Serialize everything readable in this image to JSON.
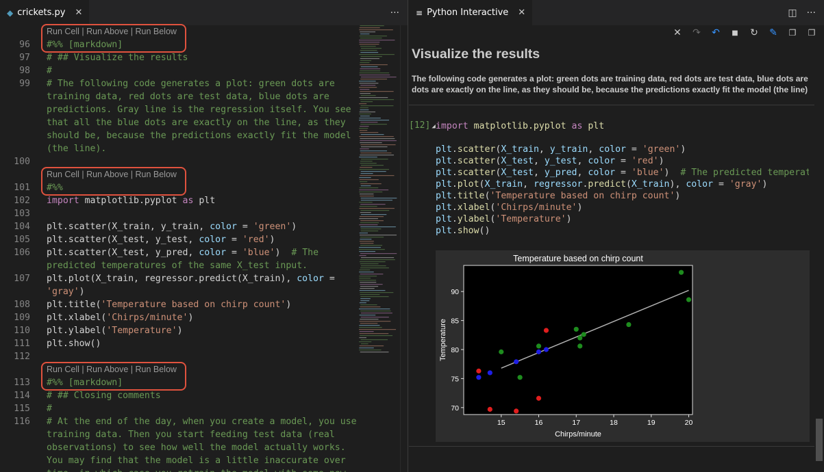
{
  "left_tab": {
    "title": "crickets.py",
    "more": "···"
  },
  "right_tab": {
    "title": "Python Interactive",
    "more": "···"
  },
  "codelens": "Run Cell | Run Above | Run Below",
  "editor_lines": [
    {
      "n": "",
      "lens": true
    },
    {
      "n": "96",
      "parts": [
        [
          "c-com",
          "#%% [markdown]"
        ]
      ]
    },
    {
      "n": "97",
      "parts": [
        [
          "c-com",
          "# ## Visualize the results"
        ]
      ]
    },
    {
      "n": "98",
      "parts": [
        [
          "c-com",
          "#"
        ]
      ]
    },
    {
      "n": "99",
      "parts": [
        [
          "c-com",
          "# The following code generates a plot: green dots are"
        ]
      ]
    },
    {
      "n": "",
      "parts": [
        [
          "c-com",
          "training data, red dots are test data, blue dots are"
        ]
      ]
    },
    {
      "n": "",
      "parts": [
        [
          "c-com",
          "predictions. Gray line is the regression itself. You see"
        ]
      ]
    },
    {
      "n": "",
      "parts": [
        [
          "c-com",
          "that all the blue dots are exactly on the line, as they"
        ]
      ]
    },
    {
      "n": "",
      "parts": [
        [
          "c-com",
          "should be, because the predictions exactly fit the model"
        ]
      ]
    },
    {
      "n": "",
      "parts": [
        [
          "c-com",
          "(the line)."
        ]
      ]
    },
    {
      "n": "100",
      "parts": []
    },
    {
      "n": "",
      "lens": true
    },
    {
      "n": "101",
      "parts": [
        [
          "c-com",
          "#%%"
        ]
      ]
    },
    {
      "n": "102",
      "parts": [
        [
          "c-kw",
          "import "
        ],
        [
          "c-def",
          "matplotlib.pyplot "
        ],
        [
          "c-kw",
          "as "
        ],
        [
          "c-def",
          "plt"
        ]
      ]
    },
    {
      "n": "103",
      "parts": []
    },
    {
      "n": "104",
      "parts": [
        [
          "c-def",
          "plt.scatter(X_train, y_train, "
        ],
        [
          "c-var",
          "color"
        ],
        [
          "c-def",
          " = "
        ],
        [
          "c-str",
          "'green'"
        ],
        [
          "c-def",
          ")"
        ]
      ]
    },
    {
      "n": "105",
      "parts": [
        [
          "c-def",
          "plt.scatter(X_test, y_test, "
        ],
        [
          "c-var",
          "color"
        ],
        [
          "c-def",
          " = "
        ],
        [
          "c-str",
          "'red'"
        ],
        [
          "c-def",
          ")"
        ]
      ]
    },
    {
      "n": "106",
      "parts": [
        [
          "c-def",
          "plt.scatter(X_test, y_pred, "
        ],
        [
          "c-var",
          "color"
        ],
        [
          "c-def",
          " = "
        ],
        [
          "c-str",
          "'blue'"
        ],
        [
          "c-def",
          ")  "
        ],
        [
          "c-com",
          "# The"
        ]
      ]
    },
    {
      "n": "",
      "parts": [
        [
          "c-com",
          "predicted temperatures of the same X_test input."
        ]
      ]
    },
    {
      "n": "107",
      "parts": [
        [
          "c-def",
          "plt.plot(X_train, regressor.predict(X_train), "
        ],
        [
          "c-var",
          "color"
        ],
        [
          "c-def",
          " ="
        ]
      ]
    },
    {
      "n": "",
      "parts": [
        [
          "c-str",
          "'gray'"
        ],
        [
          "c-def",
          ")"
        ]
      ]
    },
    {
      "n": "108",
      "parts": [
        [
          "c-def",
          "plt.title("
        ],
        [
          "c-str",
          "'Temperature based on chirp count'"
        ],
        [
          "c-def",
          ")"
        ]
      ]
    },
    {
      "n": "109",
      "parts": [
        [
          "c-def",
          "plt.xlabel("
        ],
        [
          "c-str",
          "'Chirps/minute'"
        ],
        [
          "c-def",
          ")"
        ]
      ]
    },
    {
      "n": "110",
      "parts": [
        [
          "c-def",
          "plt.ylabel("
        ],
        [
          "c-str",
          "'Temperature'"
        ],
        [
          "c-def",
          ")"
        ]
      ]
    },
    {
      "n": "111",
      "parts": [
        [
          "c-def",
          "plt.show()"
        ]
      ]
    },
    {
      "n": "112",
      "parts": []
    },
    {
      "n": "",
      "lens": true
    },
    {
      "n": "113",
      "parts": [
        [
          "c-com",
          "#%% [markdown]"
        ]
      ]
    },
    {
      "n": "114",
      "parts": [
        [
          "c-com",
          "# ## Closing comments"
        ]
      ]
    },
    {
      "n": "115",
      "parts": [
        [
          "c-com",
          "#"
        ]
      ]
    },
    {
      "n": "116",
      "parts": [
        [
          "c-com",
          "# At the end of the day, when you create a model, you use"
        ]
      ]
    },
    {
      "n": "",
      "parts": [
        [
          "c-com",
          "training data. Then you start feeding test data (real"
        ]
      ]
    },
    {
      "n": "",
      "parts": [
        [
          "c-com",
          "observations) to see how well the model actually works."
        ]
      ]
    },
    {
      "n": "",
      "parts": [
        [
          "c-com",
          "You may find that the model is a little inaccurate over"
        ]
      ]
    },
    {
      "n": "",
      "parts": [
        [
          "c-com",
          "time, in which case you retrain the model with some new"
        ]
      ]
    }
  ],
  "interactive": {
    "heading": "Visualize the results",
    "paragraph_line1": "The following code generates a plot: green dots are training data, red dots are test data, blue dots are",
    "paragraph_line2": "dots are exactly on the line, as they should be, because the predictions exactly fit the model (the line)",
    "cell_number": "[12]",
    "cell_lines": [
      [
        [
          "c-kw",
          "import "
        ],
        [
          "c-fn",
          "matplotlib.pyplot "
        ],
        [
          "c-kw",
          "as "
        ],
        [
          "c-fn",
          "plt"
        ]
      ],
      [],
      [
        [
          "c-var",
          "plt"
        ],
        [
          "c-def",
          "."
        ],
        [
          "c-fn",
          "scatter"
        ],
        [
          "c-def",
          "("
        ],
        [
          "c-var",
          "X_train"
        ],
        [
          "c-def",
          ", "
        ],
        [
          "c-var",
          "y_train"
        ],
        [
          "c-def",
          ", "
        ],
        [
          "c-var",
          "color"
        ],
        [
          "c-def",
          " = "
        ],
        [
          "c-str",
          "'green'"
        ],
        [
          "c-def",
          ")"
        ]
      ],
      [
        [
          "c-var",
          "plt"
        ],
        [
          "c-def",
          "."
        ],
        [
          "c-fn",
          "scatter"
        ],
        [
          "c-def",
          "("
        ],
        [
          "c-var",
          "X_test"
        ],
        [
          "c-def",
          ", "
        ],
        [
          "c-var",
          "y_test"
        ],
        [
          "c-def",
          ", "
        ],
        [
          "c-var",
          "color"
        ],
        [
          "c-def",
          " = "
        ],
        [
          "c-str",
          "'red'"
        ],
        [
          "c-def",
          ")"
        ]
      ],
      [
        [
          "c-var",
          "plt"
        ],
        [
          "c-def",
          "."
        ],
        [
          "c-fn",
          "scatter"
        ],
        [
          "c-def",
          "("
        ],
        [
          "c-var",
          "X_test"
        ],
        [
          "c-def",
          ", "
        ],
        [
          "c-var",
          "y_pred"
        ],
        [
          "c-def",
          ", "
        ],
        [
          "c-var",
          "color"
        ],
        [
          "c-def",
          " = "
        ],
        [
          "c-str",
          "'blue'"
        ],
        [
          "c-def",
          ")  "
        ],
        [
          "c-com",
          "# The predicted temperatur"
        ]
      ],
      [
        [
          "c-var",
          "plt"
        ],
        [
          "c-def",
          "."
        ],
        [
          "c-fn",
          "plot"
        ],
        [
          "c-def",
          "("
        ],
        [
          "c-var",
          "X_train"
        ],
        [
          "c-def",
          ", "
        ],
        [
          "c-var",
          "regressor"
        ],
        [
          "c-def",
          "."
        ],
        [
          "c-fn",
          "predict"
        ],
        [
          "c-def",
          "("
        ],
        [
          "c-var",
          "X_train"
        ],
        [
          "c-def",
          "), "
        ],
        [
          "c-var",
          "color"
        ],
        [
          "c-def",
          " = "
        ],
        [
          "c-str",
          "'gray'"
        ],
        [
          "c-def",
          ")"
        ]
      ],
      [
        [
          "c-var",
          "plt"
        ],
        [
          "c-def",
          "."
        ],
        [
          "c-fn",
          "title"
        ],
        [
          "c-def",
          "("
        ],
        [
          "c-str",
          "'Temperature based on chirp count'"
        ],
        [
          "c-def",
          ")"
        ]
      ],
      [
        [
          "c-var",
          "plt"
        ],
        [
          "c-def",
          "."
        ],
        [
          "c-fn",
          "xlabel"
        ],
        [
          "c-def",
          "("
        ],
        [
          "c-str",
          "'Chirps/minute'"
        ],
        [
          "c-def",
          ")"
        ]
      ],
      [
        [
          "c-var",
          "plt"
        ],
        [
          "c-def",
          "."
        ],
        [
          "c-fn",
          "ylabel"
        ],
        [
          "c-def",
          "("
        ],
        [
          "c-str",
          "'Temperature'"
        ],
        [
          "c-def",
          ")"
        ]
      ],
      [
        [
          "c-var",
          "plt"
        ],
        [
          "c-def",
          "."
        ],
        [
          "c-fn",
          "show"
        ],
        [
          "c-def",
          "()"
        ]
      ]
    ]
  },
  "chart_data": {
    "type": "scatter",
    "title": "Temperature based on chirp count",
    "xlabel": "Chirps/minute",
    "ylabel": "Temperature",
    "xlim": [
      14,
      20.1
    ],
    "ylim": [
      68.8,
      94.5
    ],
    "xticks": [
      15,
      16,
      17,
      18,
      19,
      20
    ],
    "yticks": [
      70,
      75,
      80,
      85,
      90
    ],
    "grid": false,
    "series": [
      {
        "color": "#1e8c1e",
        "points": [
          [
            15.0,
            79.6
          ],
          [
            15.5,
            75.2
          ],
          [
            16.0,
            80.6
          ],
          [
            17.0,
            83.5
          ],
          [
            17.1,
            82.0
          ],
          [
            17.2,
            82.6
          ],
          [
            17.1,
            80.6
          ],
          [
            18.4,
            84.3
          ],
          [
            19.8,
            93.3
          ],
          [
            20.0,
            88.6
          ]
        ]
      },
      {
        "color": "#e01e1e",
        "points": [
          [
            14.4,
            76.3
          ],
          [
            14.7,
            69.7
          ],
          [
            15.4,
            69.4
          ],
          [
            16.0,
            71.6
          ],
          [
            16.2,
            83.3
          ]
        ]
      },
      {
        "color": "#1e1ee6",
        "points": [
          [
            14.4,
            75.2
          ],
          [
            14.7,
            76.0
          ],
          [
            15.4,
            77.9
          ],
          [
            16.0,
            79.6
          ],
          [
            16.2,
            80.0
          ]
        ]
      }
    ],
    "line": {
      "color": "#b0b0b0",
      "points": [
        [
          15.0,
          76.8
        ],
        [
          20.0,
          90.2
        ]
      ]
    }
  }
}
